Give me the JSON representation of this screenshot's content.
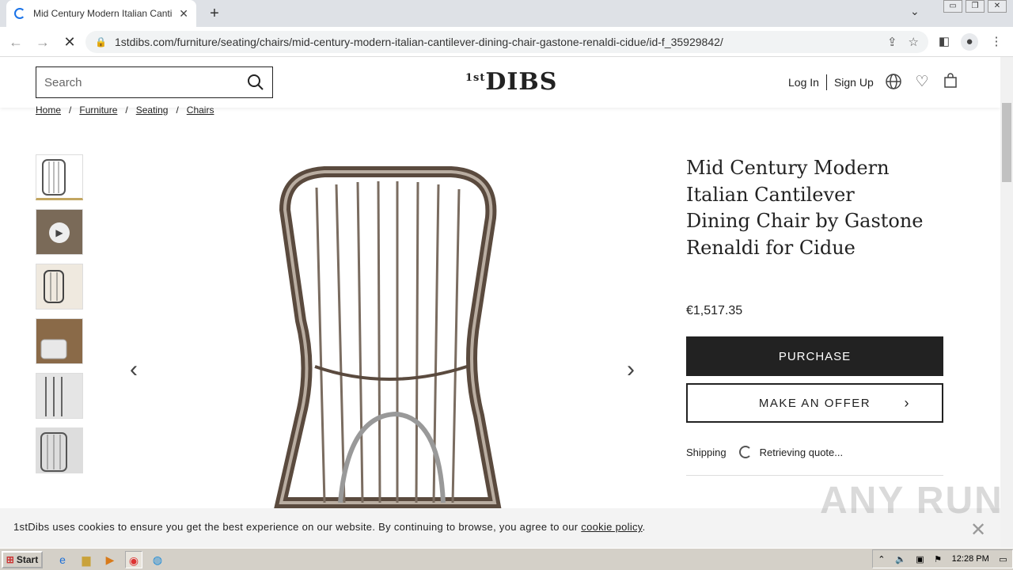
{
  "browser": {
    "tab_title": "Mid Century Modern Italian Cantilever",
    "url": "1stdibs.com/furniture/seating/chairs/mid-century-modern-italian-cantilever-dining-chair-gastone-renaldi-cidue/id-f_35929842/"
  },
  "site": {
    "search_placeholder": "Search",
    "logo_main": "DIBS",
    "logo_sup": "1st",
    "login": "Log In",
    "signup": "Sign Up"
  },
  "breadcrumb": [
    "Home",
    "Furniture",
    "Seating",
    "Chairs"
  ],
  "product": {
    "title": "Mid Century Modern Italian Cantilever Dining Chair by Gastone Renaldi for Cidue",
    "price": "€1,517.35",
    "purchase_label": "PURCHASE",
    "offer_label": "MAKE AN OFFER",
    "shipping_label": "Shipping",
    "shipping_status": "Retrieving quote..."
  },
  "cookie": {
    "text": "1stDibs uses cookies to ensure you get the best experience on our website. By continuing to browse, you agree to our ",
    "link": "cookie policy",
    "end": "."
  },
  "watermark": "ANY RUN",
  "taskbar": {
    "start": "Start",
    "clock": "12:28 PM"
  }
}
